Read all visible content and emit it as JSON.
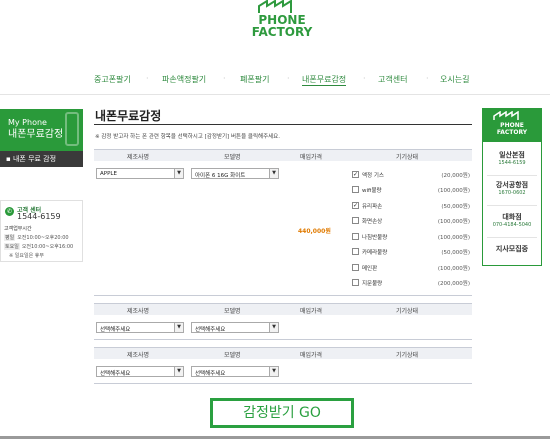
{
  "header": {
    "logo_line1": "PHONE",
    "logo_line2": "FACTORY"
  },
  "nav": {
    "items": [
      "중고폰팔기",
      "파손액정팔기",
      "폐폰팔기",
      "내폰무료감정",
      "고객센터",
      "오시는길"
    ]
  },
  "sidebar": {
    "box_line1": "My Phone",
    "box_line2": "내폰무료감정",
    "menu_item": "▪ 내폰 무료 감정",
    "cs": {
      "title": "고객 센터",
      "phone": "1544-6159",
      "hours_title": "고객업무시간",
      "weekday_label": "평일",
      "weekday_hours": "오전10:00~오후20:00",
      "saturday_label": "토요일",
      "saturday_hours": "오전10:00~오후16:00",
      "holiday": "※ 일요일은 휴무"
    }
  },
  "main": {
    "title": "내폰무료감정",
    "notice": "※ 감정 받고자 하는 폰 관련 항목을 선택하시고 [감정받기] 버튼을 클릭해주세요.",
    "headers": [
      "제조사명",
      "모델명",
      "매입가격",
      "기기상태"
    ],
    "row1": {
      "maker": "APPLE",
      "model": "아이폰 6 16G 화이트",
      "price": "440,000원"
    },
    "conditions": [
      {
        "label": "액정 기스",
        "price": "(20,000원)",
        "checked": true
      },
      {
        "label": "wifi불량",
        "price": "(100,000원)",
        "checked": false
      },
      {
        "label": "유리파손",
        "price": "(50,000원)",
        "checked": true
      },
      {
        "label": "화면손상",
        "price": "(100,000원)",
        "checked": false
      },
      {
        "label": "나침반불량",
        "price": "(100,000원)",
        "checked": false
      },
      {
        "label": "카메라불량",
        "price": "(50,000원)",
        "checked": false
      },
      {
        "label": "메인판",
        "price": "(100,000원)",
        "checked": false
      },
      {
        "label": "지문불량",
        "price": "(200,000원)",
        "checked": false
      }
    ],
    "placeholder_select": "선택해주세요",
    "go_button": "감정받기 GO"
  },
  "right_sidebar": {
    "logo_line1": "PHONE",
    "logo_line2": "FACTORY",
    "stores": [
      {
        "name": "일산본점",
        "phone": "1544-6159"
      },
      {
        "name": "강서공항점",
        "phone": "1670-0602"
      },
      {
        "name": "대화점",
        "phone": "070-4184-5040"
      },
      {
        "name": "지사모집중",
        "phone": ""
      }
    ]
  },
  "colors": {
    "brand_green": "#2a9a3a",
    "price_orange": "#e07a00"
  }
}
